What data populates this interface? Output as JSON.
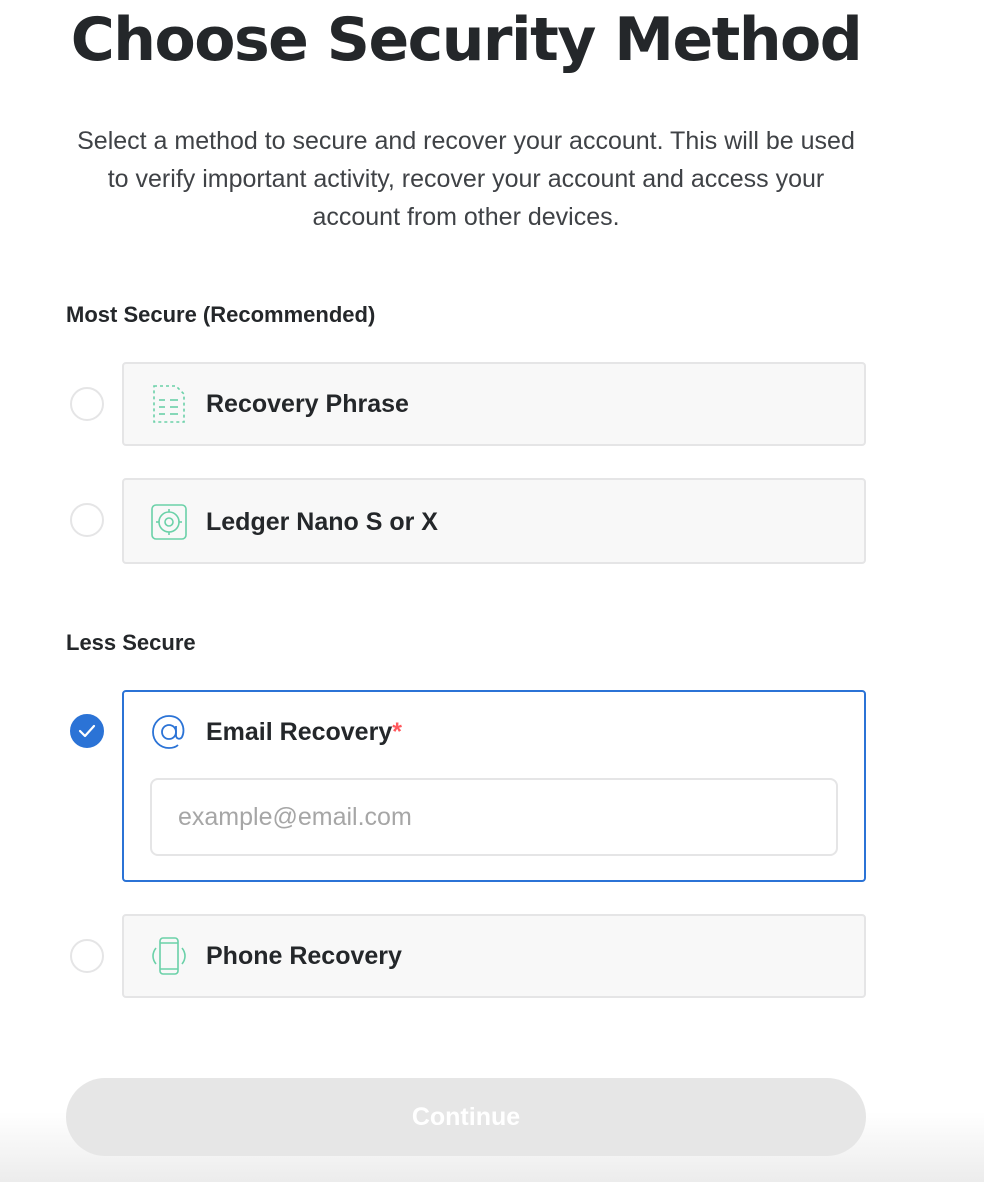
{
  "header": {
    "title": "Choose Security Method",
    "description": "Select a method to secure and recover your account. This will be used to verify important activity, recover your account and access your account from other devices."
  },
  "sections": {
    "most_secure": {
      "heading": "Most Secure (Recommended)",
      "options": [
        {
          "label": "Recovery Phrase",
          "icon": "document-icon",
          "selected": false
        },
        {
          "label": "Ledger Nano S or X",
          "icon": "ledger-icon",
          "selected": false
        }
      ]
    },
    "less_secure": {
      "heading": "Less Secure",
      "options": [
        {
          "label": "Email Recovery",
          "required_mark": "*",
          "icon": "at-sign-icon",
          "selected": true
        },
        {
          "label": "Phone Recovery",
          "icon": "phone-icon",
          "selected": false
        }
      ]
    }
  },
  "email": {
    "value": "",
    "placeholder": "example@email.com"
  },
  "continue_button": {
    "label": "Continue",
    "enabled": false
  },
  "colors": {
    "accent": "#2b73d6",
    "icon_green": "#6ad1a8",
    "required": "#ff585d",
    "disabled_button": "#e6e6e6"
  }
}
